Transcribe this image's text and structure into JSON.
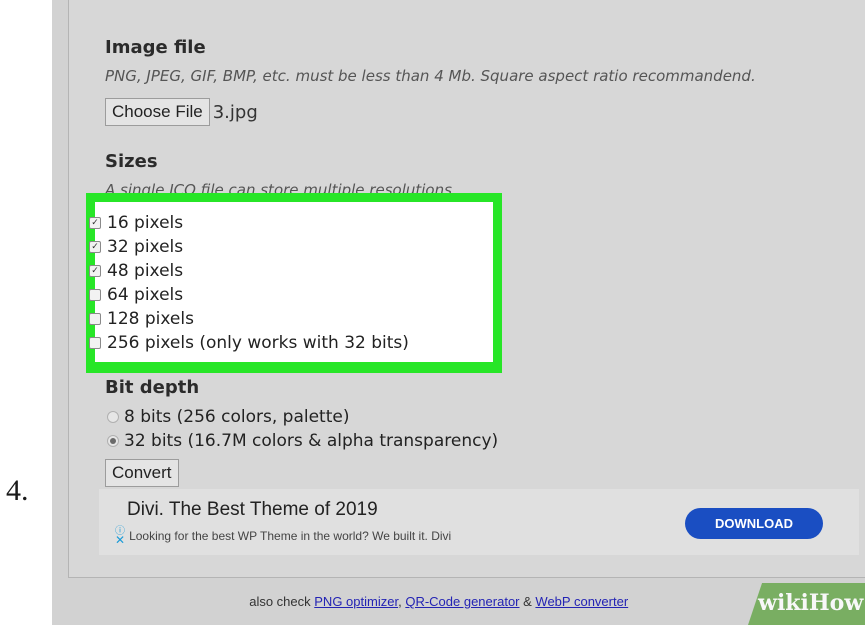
{
  "step_number": "4.",
  "image_file": {
    "heading": "Image file",
    "note": "PNG, JPEG, GIF, BMP, etc. must be less than 4 Mb. Square aspect ratio recommandend.",
    "choose_button": "Choose File",
    "file_name": "3.jpg"
  },
  "sizes": {
    "heading": "Sizes",
    "note": "A single ICO file can store multiple resolutions.",
    "options": [
      {
        "label": "16 pixels",
        "checked": true
      },
      {
        "label": "32 pixels",
        "checked": true
      },
      {
        "label": "48 pixels",
        "checked": true
      },
      {
        "label": "64 pixels",
        "checked": false
      },
      {
        "label": "128 pixels",
        "checked": false
      },
      {
        "label": "256 pixels (only works with 32 bits)",
        "checked": false
      }
    ],
    "highlight_color": "#27e627"
  },
  "bit_depth": {
    "heading": "Bit depth",
    "options": [
      {
        "label": "8 bits (256 colors, palette)",
        "selected": false
      },
      {
        "label": "32 bits (16.7M colors & alpha transparency)",
        "selected": true
      }
    ]
  },
  "convert_button": "Convert",
  "ad": {
    "title": "Divi. The Best Theme of 2019",
    "subtitle": "Looking for the best WP Theme in the world? We built it. Divi",
    "download_button": "DOWNLOAD",
    "info_icon": "info-icon",
    "close_icon": "close-icon",
    "button_color": "#1a4ec2"
  },
  "footer": {
    "prefix": "also check",
    "link1": "PNG optimizer",
    "sep": ",",
    "link2": "QR-Code generator",
    "amp": "&",
    "link3": "WebP converter"
  },
  "watermark": "wikiHow"
}
